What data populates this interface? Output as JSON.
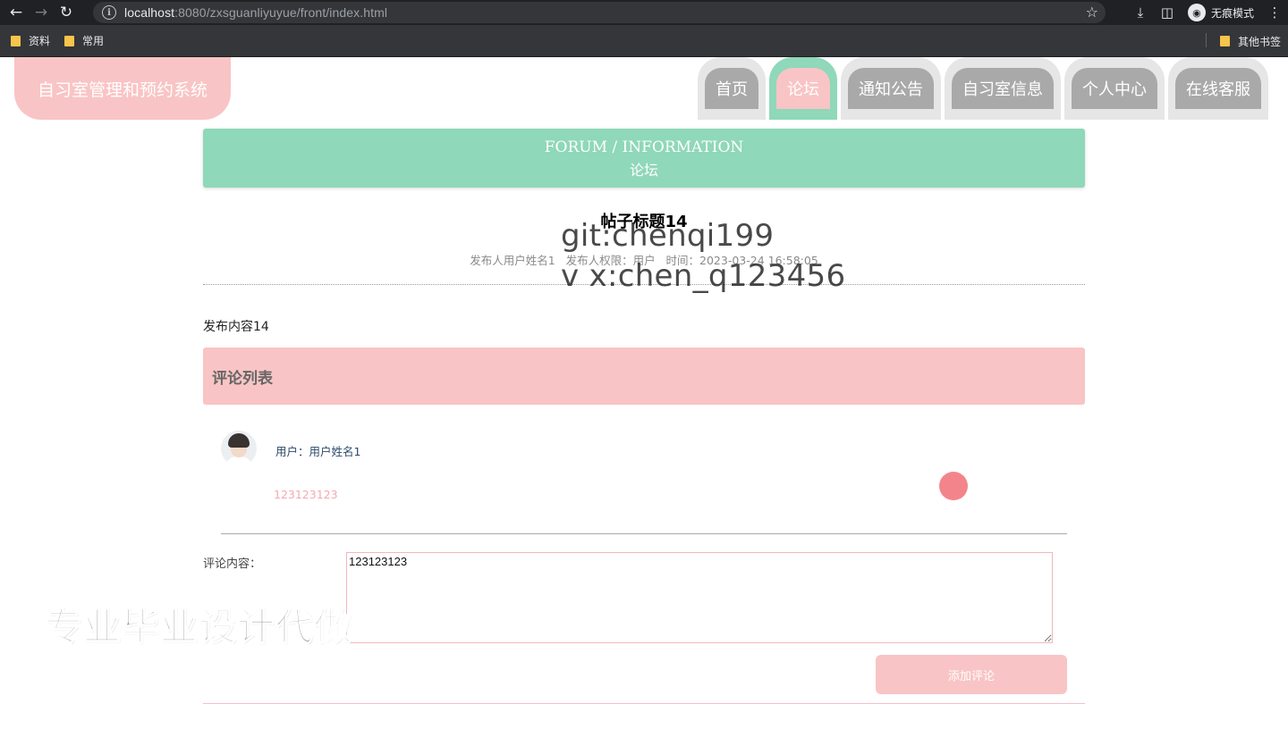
{
  "browser": {
    "url_host": "localhost",
    "url_rest": ":8080/zxsguanliyuyue/front/index.html",
    "incognito_label": "无痕模式",
    "bookmarks": [
      "资料",
      "常用"
    ],
    "other_bookmarks": "其他书签"
  },
  "site": {
    "logo": "自习室管理和预约系统",
    "menu": [
      {
        "label": "首页",
        "active": false
      },
      {
        "label": "论坛",
        "active": true
      },
      {
        "label": "通知公告",
        "active": false
      },
      {
        "label": "自习室信息",
        "active": false
      },
      {
        "label": "个人中心",
        "active": false
      },
      {
        "label": "在线客服",
        "active": false
      }
    ],
    "accent_green": "#8fd8b9",
    "accent_pink": "#f9c4c5"
  },
  "banner": {
    "en": "FORUM / INFORMATION",
    "zh": "论坛"
  },
  "post": {
    "title": "帖子标题14",
    "meta": "发布人用户姓名1   发布人权限：用户   时间：2023-03-24 16:58:05",
    "content": "发布内容14"
  },
  "comments": {
    "header": "评论列表",
    "items": [
      {
        "user": "用户：用户姓名1",
        "text": "123123123"
      }
    ]
  },
  "form": {
    "label": "评论内容：",
    "value": "123123123",
    "submit": "添加评论"
  },
  "watermarks": {
    "git": "git:chenqi199",
    "vx": "v x:chen_q123456",
    "big": "专业毕业设计代做"
  }
}
